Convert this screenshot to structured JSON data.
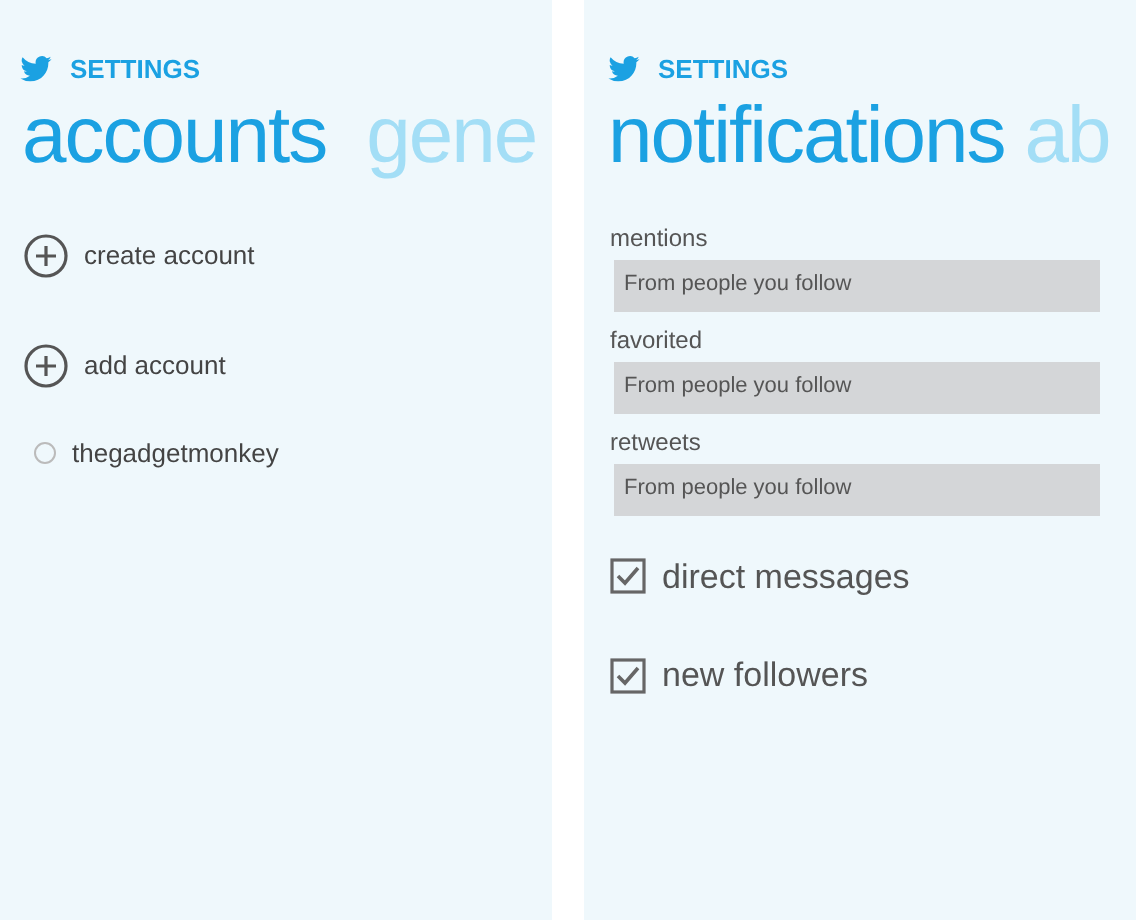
{
  "panels": [
    {
      "app_title": "SETTINGS",
      "pivots": [
        {
          "label": "accounts",
          "selected": true
        },
        {
          "label": "gene",
          "selected": false
        }
      ],
      "items": [
        {
          "kind": "action",
          "label": "create account"
        },
        {
          "kind": "action",
          "label": "add account"
        },
        {
          "kind": "radio",
          "label": "thegadgetmonkey",
          "selected": false
        }
      ]
    },
    {
      "app_title": "SETTINGS",
      "pivots": [
        {
          "label": "notifications",
          "selected": true
        },
        {
          "label": "ab",
          "selected": false
        }
      ],
      "items": [
        {
          "kind": "dropdown",
          "label": "mentions",
          "value": "From people you follow"
        },
        {
          "kind": "dropdown",
          "label": "favorited",
          "value": "From people you follow"
        },
        {
          "kind": "dropdown",
          "label": "retweets",
          "value": "From people you follow"
        },
        {
          "kind": "checkbox",
          "label": "direct messages",
          "checked": true
        },
        {
          "kind": "checkbox",
          "label": "new followers",
          "checked": true
        }
      ]
    }
  ]
}
